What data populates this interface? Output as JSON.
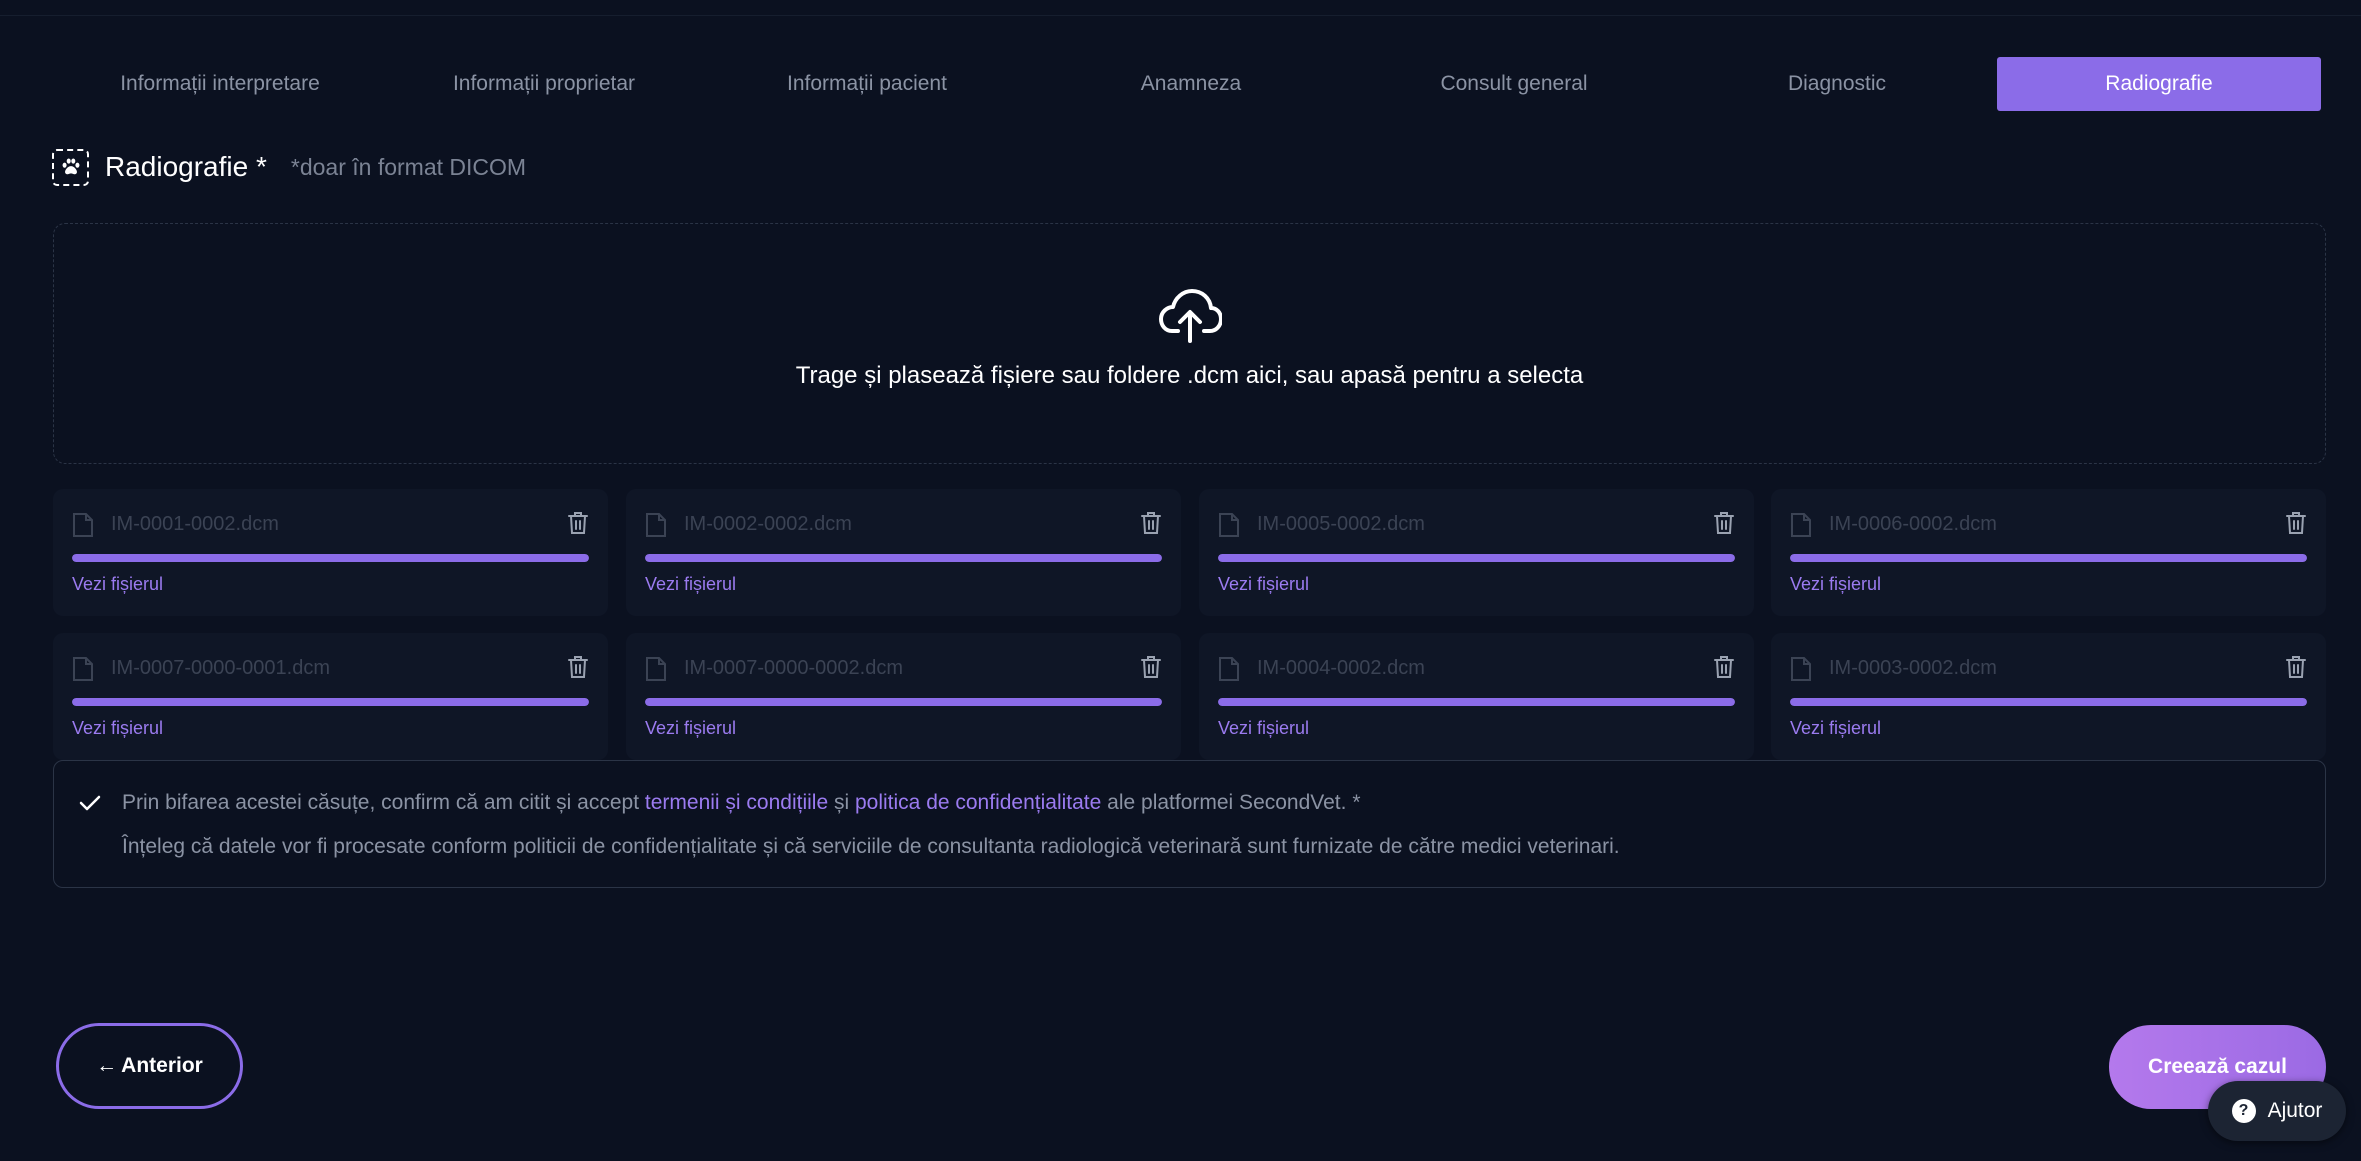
{
  "tabs": [
    {
      "label": "Informații interpretare"
    },
    {
      "label": "Informații proprietar"
    },
    {
      "label": "Informații pacient"
    },
    {
      "label": "Anamneza"
    },
    {
      "label": "Consult general"
    },
    {
      "label": "Diagnostic"
    },
    {
      "label": "Radiografie",
      "active": true
    }
  ],
  "section": {
    "title": "Radiografie *",
    "note": "*doar în format DICOM",
    "icon": "paw-icon"
  },
  "dropzone": {
    "icon": "cloud-upload-icon",
    "text": "Trage și plasează fișiere sau foldere .dcm aici, sau apasă pentru a selecta"
  },
  "files": [
    {
      "name": "IM-0001-0002.dcm",
      "progress": 1.0,
      "link": "Vezi fișierul"
    },
    {
      "name": "IM-0002-0002.dcm",
      "progress": 1.0,
      "link": "Vezi fișierul"
    },
    {
      "name": "IM-0005-0002.dcm",
      "progress": 1.0,
      "link": "Vezi fișierul"
    },
    {
      "name": "IM-0006-0002.dcm",
      "progress": 1.0,
      "link": "Vezi fișierul"
    },
    {
      "name": "IM-0007-0000-0001.dcm",
      "progress": 1.0,
      "link": "Vezi fișierul"
    },
    {
      "name": "IM-0007-0000-0002.dcm",
      "progress": 1.0,
      "link": "Vezi fișierul"
    },
    {
      "name": "IM-0004-0002.dcm",
      "progress": 1.0,
      "link": "Vezi fișierul"
    },
    {
      "name": "IM-0003-0002.dcm",
      "progress": 1.0,
      "link": "Vezi fișierul"
    }
  ],
  "consent": {
    "checked": true,
    "line1_pre": "Prin bifarea acestei căsuțe, confirm că am citit și accept ",
    "terms_link": "termenii și condițiile",
    "line1_mid": " și ",
    "privacy_link": "politica de confidențialitate",
    "line1_post": " ale platformei SecondVet. *",
    "line2": "Înțeleg că datele vor fi procesate conform politicii de confidențialitate și că serviciile de consultanta radiologică veterinară sunt furnizate de către medici veterinari."
  },
  "buttons": {
    "prev_arrow": "←",
    "prev_label": "Anterior",
    "create_label": "Creează cazul",
    "help_label": "Ajutor",
    "help_glyph": "?"
  },
  "colors": {
    "accent": "#8b6ce8",
    "background": "#0b1120",
    "link": "#9b7bf0"
  }
}
